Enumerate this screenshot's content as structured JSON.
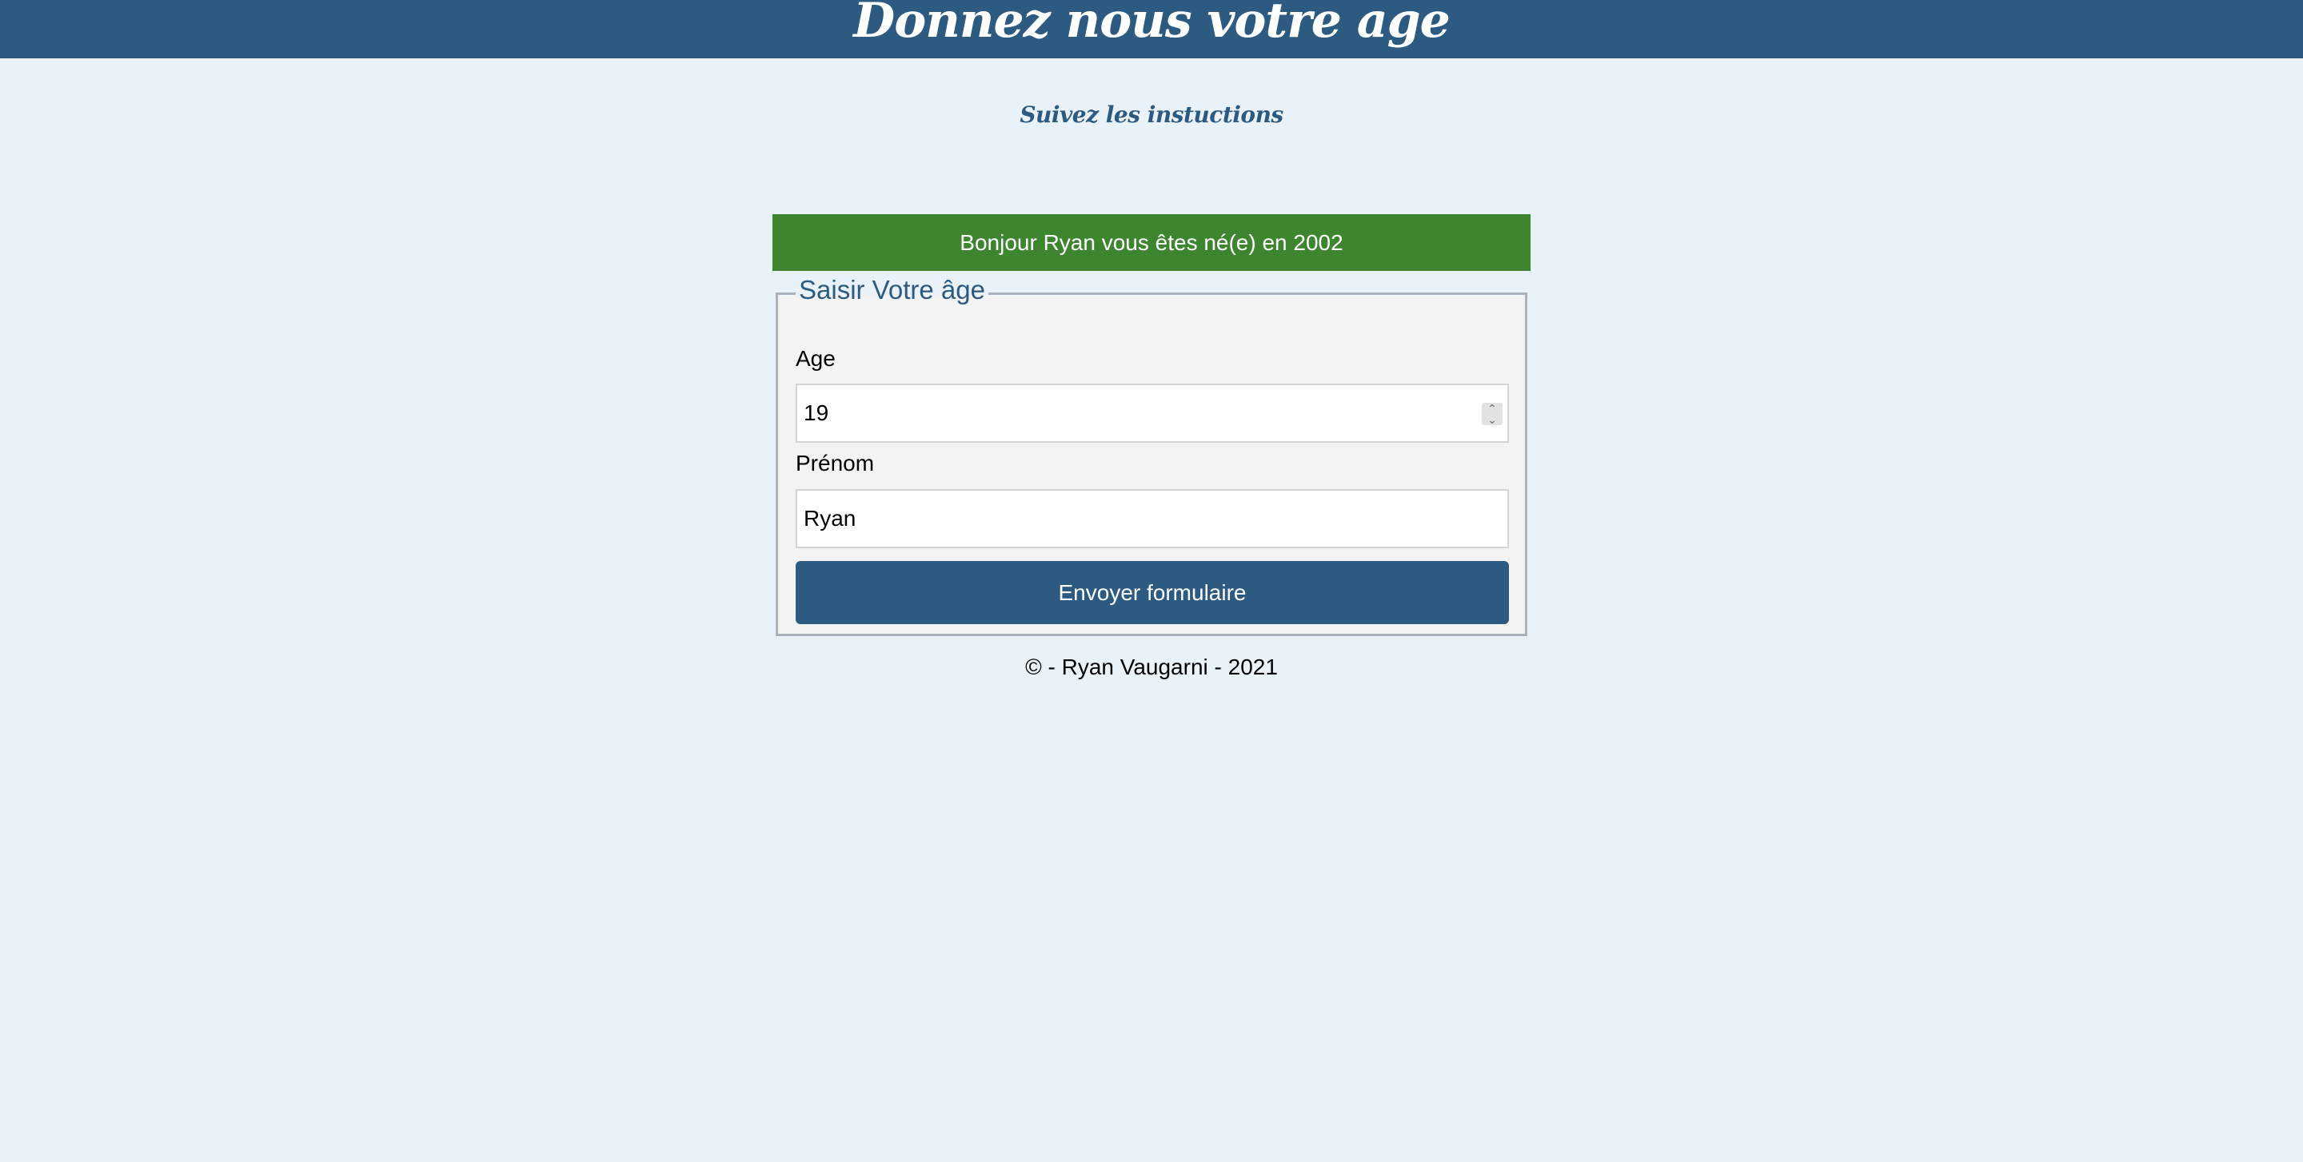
{
  "header": {
    "title": "Donnez nous votre age"
  },
  "subtitle": "Suivez les instuctions",
  "alert": {
    "message": "Bonjour Ryan vous êtes né(e) en 2002",
    "color": "#3e8530"
  },
  "form": {
    "legend": "Saisir Votre âge",
    "age_label": "Age",
    "age_value": "19",
    "prenom_label": "Prénom",
    "prenom_value": "Ryan",
    "submit_label": "Envoyer formulaire"
  },
  "footer": {
    "text": "© - Ryan Vaugarni - 2021"
  },
  "colors": {
    "primary": "#2d5a80",
    "background": "#eaf2f9",
    "success": "#3e8530"
  },
  "icons": {
    "stepper": "chevron-up-down-icon"
  }
}
